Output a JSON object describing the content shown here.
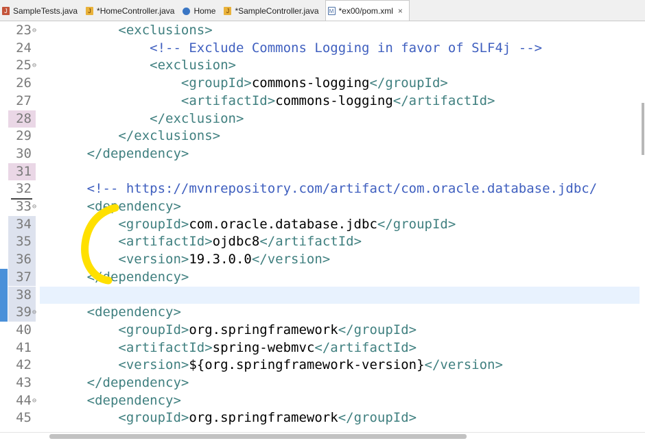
{
  "tabs": [
    {
      "label": "SampleTests.java",
      "icon": "junit-file-icon",
      "active": false
    },
    {
      "label": "*HomeController.java",
      "icon": "java-file-icon",
      "active": false
    },
    {
      "label": "Home",
      "icon": "browser-globe-icon",
      "active": false
    },
    {
      "label": "*SampleController.java",
      "icon": "java-file-icon",
      "active": false
    },
    {
      "label": "*ex00/pom.xml",
      "icon": "xml-file-icon",
      "active": true,
      "close": "×"
    }
  ],
  "lines": [
    {
      "n": "23",
      "fold": "⊖",
      "indent": "          ",
      "parts": [
        [
          "tag",
          "<exclusions>"
        ]
      ]
    },
    {
      "n": "24",
      "indent": "              ",
      "parts": [
        [
          "comment",
          "<!-- Exclude Commons Logging in favor of SLF4j -->"
        ]
      ]
    },
    {
      "n": "25",
      "fold": "⊖",
      "indent": "              ",
      "parts": [
        [
          "tag",
          "<exclusion>"
        ]
      ]
    },
    {
      "n": "26",
      "indent": "                  ",
      "parts": [
        [
          "tag",
          "<groupId>"
        ],
        [
          "txt",
          "commons-logging"
        ],
        [
          "tag",
          "</groupId>"
        ]
      ]
    },
    {
      "n": "27",
      "indent": "                  ",
      "parts": [
        [
          "tag",
          "<artifactId>"
        ],
        [
          "txt",
          "commons-logging"
        ],
        [
          "tag",
          "</artifactId>"
        ]
      ]
    },
    {
      "n": "28",
      "bg": "pink",
      "indent": "              ",
      "parts": [
        [
          "tag",
          "</exclusion>"
        ]
      ]
    },
    {
      "n": "29",
      "indent": "          ",
      "parts": [
        [
          "tag",
          "</exclusions>"
        ]
      ]
    },
    {
      "n": "30",
      "indent": "      ",
      "parts": [
        [
          "tag",
          "</dependency>"
        ]
      ]
    },
    {
      "n": "31",
      "bg": "pink",
      "indent": "",
      "parts": []
    },
    {
      "n": "32",
      "indent": "      ",
      "parts": [
        [
          "comment",
          "<!-- https://mvnrepository.com/artifact/com.oracle.database.jdbc/"
        ]
      ]
    },
    {
      "n": "33",
      "fold": "⊖",
      "indent": "      ",
      "parts": [
        [
          "tag",
          "<dependency>"
        ]
      ]
    },
    {
      "n": "34",
      "bg": "lav",
      "indent": "          ",
      "parts": [
        [
          "tag",
          "<groupId>"
        ],
        [
          "txt",
          "com.oracle.database.jdbc"
        ],
        [
          "tag",
          "</groupId>"
        ]
      ]
    },
    {
      "n": "35",
      "bg": "lav",
      "indent": "          ",
      "parts": [
        [
          "tag",
          "<artifactId>"
        ],
        [
          "txt",
          "ojdbc8"
        ],
        [
          "tag",
          "</artifactId>"
        ]
      ]
    },
    {
      "n": "36",
      "bg": "lav",
      "indent": "          ",
      "parts": [
        [
          "tag",
          "<version>"
        ],
        [
          "txt",
          "19.3.0.0"
        ],
        [
          "tag",
          "</version>"
        ]
      ]
    },
    {
      "n": "37",
      "bg": "lav",
      "indent": "      ",
      "parts": [
        [
          "tag",
          "</dependency>"
        ]
      ]
    },
    {
      "n": "38",
      "bg": "lav",
      "current": true,
      "indent": "",
      "parts": []
    },
    {
      "n": "39",
      "fold": "⊖",
      "bg": "lav",
      "indent": "      ",
      "parts": [
        [
          "tag",
          "<dependency>"
        ]
      ]
    },
    {
      "n": "40",
      "indent": "          ",
      "parts": [
        [
          "tag",
          "<groupId>"
        ],
        [
          "txt",
          "org.springframework"
        ],
        [
          "tag",
          "</groupId>"
        ]
      ]
    },
    {
      "n": "41",
      "indent": "          ",
      "parts": [
        [
          "tag",
          "<artifactId>"
        ],
        [
          "txt",
          "spring-webmvc"
        ],
        [
          "tag",
          "</artifactId>"
        ]
      ]
    },
    {
      "n": "42",
      "indent": "          ",
      "parts": [
        [
          "tag",
          "<version>"
        ],
        [
          "txt",
          "${org.springframework-version}"
        ],
        [
          "tag",
          "</version>"
        ]
      ]
    },
    {
      "n": "43",
      "indent": "      ",
      "parts": [
        [
          "tag",
          "</dependency>"
        ]
      ]
    },
    {
      "n": "44",
      "fold": "⊖",
      "indent": "      ",
      "parts": [
        [
          "tag",
          "<dependency>"
        ]
      ]
    },
    {
      "n": "45",
      "indent": "          ",
      "parts": [
        [
          "tag",
          "<groupId>"
        ],
        [
          "txt",
          "org.springframework"
        ],
        [
          "tag",
          "</groupId>"
        ]
      ]
    }
  ],
  "colors": {
    "tag": "#3f7f7f",
    "comment": "#3f5fbf",
    "annotation": "#ffe000",
    "change_marker": "#4a90d9"
  }
}
